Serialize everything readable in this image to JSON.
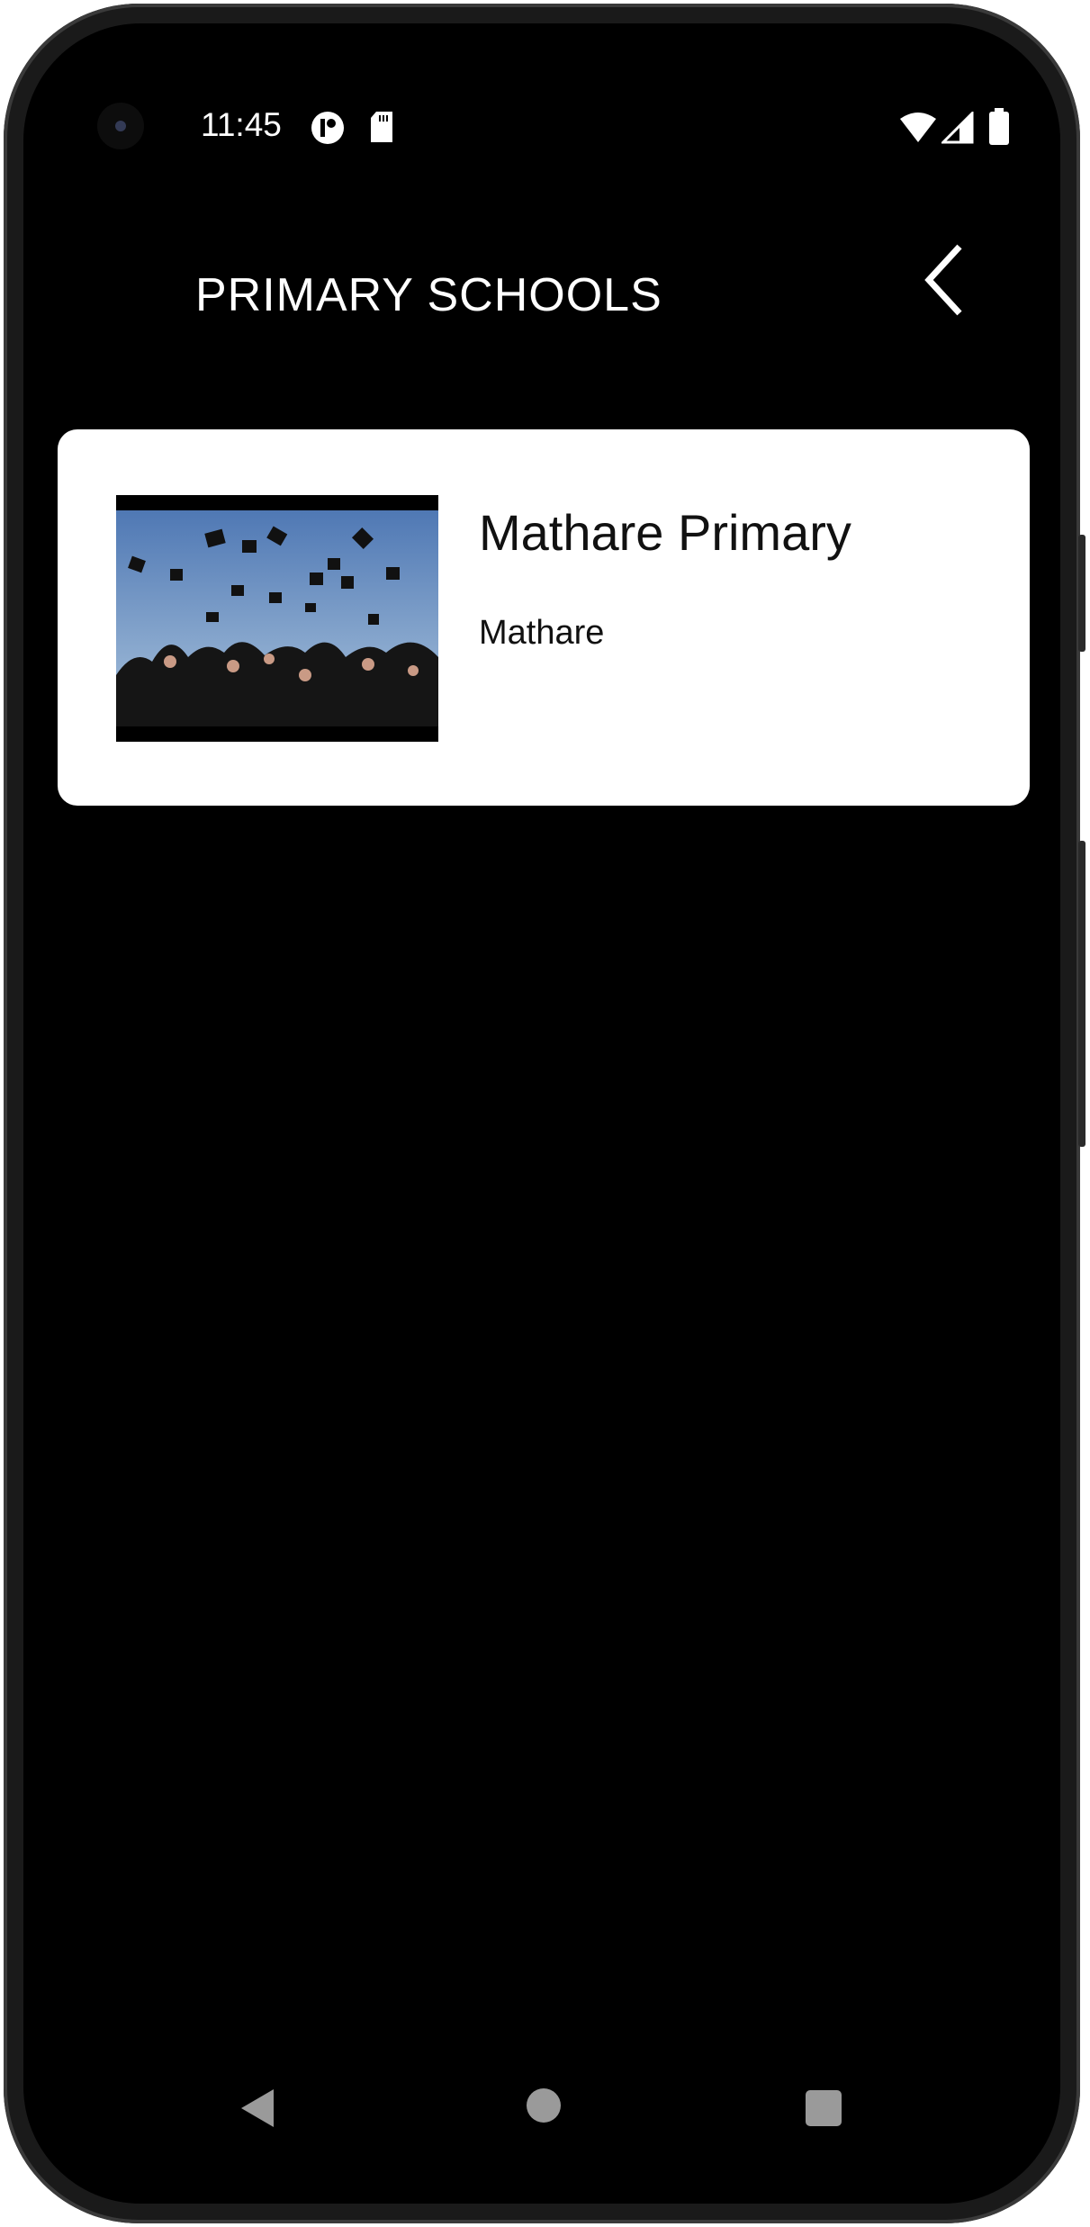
{
  "status_bar": {
    "time": "11:45",
    "left_icons": [
      "app-notification-icon",
      "sd-card-icon"
    ],
    "right_icons": [
      "wifi-icon",
      "signal-icon",
      "battery-icon"
    ]
  },
  "header": {
    "title": "PRIMARY SCHOOLS",
    "back_icon": "chevron-left-icon"
  },
  "schools": [
    {
      "name": "Mathare Primary",
      "location": "Mathare",
      "image": "graduation caps photo"
    }
  ],
  "nav_bar": {
    "buttons": [
      "back",
      "home",
      "recents"
    ]
  },
  "colors": {
    "background": "#000000",
    "card": "#ffffff",
    "text_on_dark": "#ffffff",
    "nav_buttons": "#9a9a9a"
  }
}
